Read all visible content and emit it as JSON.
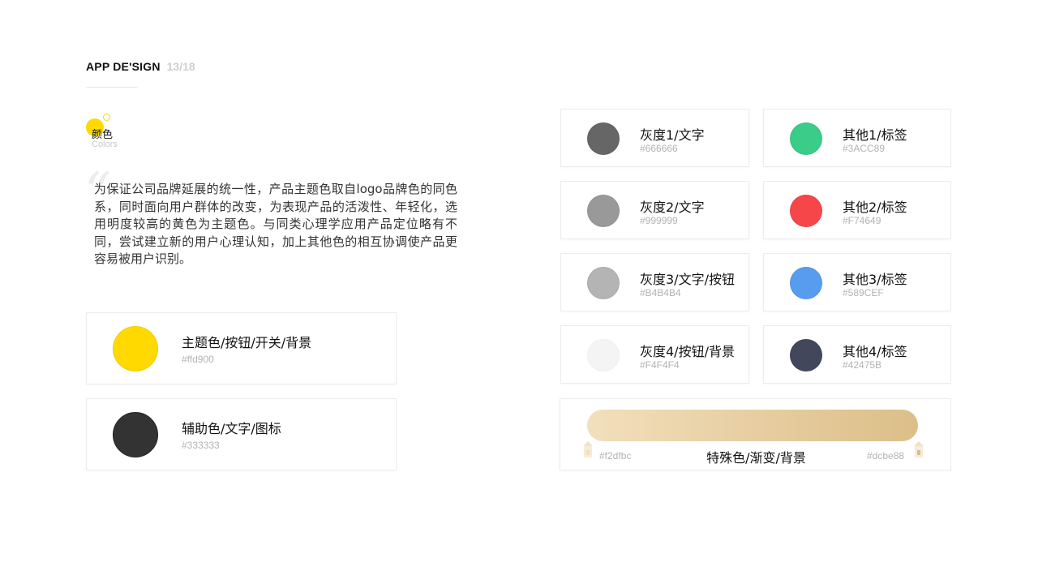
{
  "header": {
    "title": "APP DE'SIGN",
    "page": "13/18"
  },
  "section": {
    "title": "颜色",
    "subtitle": "Colors"
  },
  "description": "为保证公司品牌延展的统一性，产品主题色取自logo品牌色的同色系，同时面向用户群体的改变，为表现产品的活泼性、年轻化，选用明度较高的黄色为主题色。与同类心理学应用产品定位略有不同，尝试建立新的用户心理认知，加上其他色的相互协调使产品更容易被用户识别。",
  "primary_colors": [
    {
      "name": "主题色/按钮/开关/背景",
      "hex": "#ffd900",
      "color": "#ffd900"
    },
    {
      "name": "辅助色/文字/图标",
      "hex": "#333333",
      "color": "#333333"
    }
  ],
  "gray_colors": [
    {
      "name": "灰度1/文字",
      "hex": "#666666",
      "color": "#666666"
    },
    {
      "name": "灰度2/文字",
      "hex": "#999999",
      "color": "#999999"
    },
    {
      "name": "灰度3/文字/按钮",
      "hex": "#B4B4B4",
      "color": "#B4B4B4"
    },
    {
      "name": "灰度4/按钮/背景",
      "hex": "#F4F4F4",
      "color": "#F4F4F4"
    }
  ],
  "other_colors": [
    {
      "name": "其他1/标签",
      "hex": "#3ACC89",
      "color": "#3ACC89"
    },
    {
      "name": "其他2/标签",
      "hex": "#F74649",
      "color": "#F74649"
    },
    {
      "name": "其他3/标签",
      "hex": "#589CEF",
      "color": "#589CEF"
    },
    {
      "name": "其他4/标签",
      "hex": "#42475B",
      "color": "#42475B"
    }
  ],
  "gradient": {
    "name": "特殊色/渐变/背景",
    "start_hex": "#f2dfbc",
    "end_hex": "#dcbe88",
    "start_color": "#f2dfbc",
    "end_color": "#dcbe88"
  }
}
